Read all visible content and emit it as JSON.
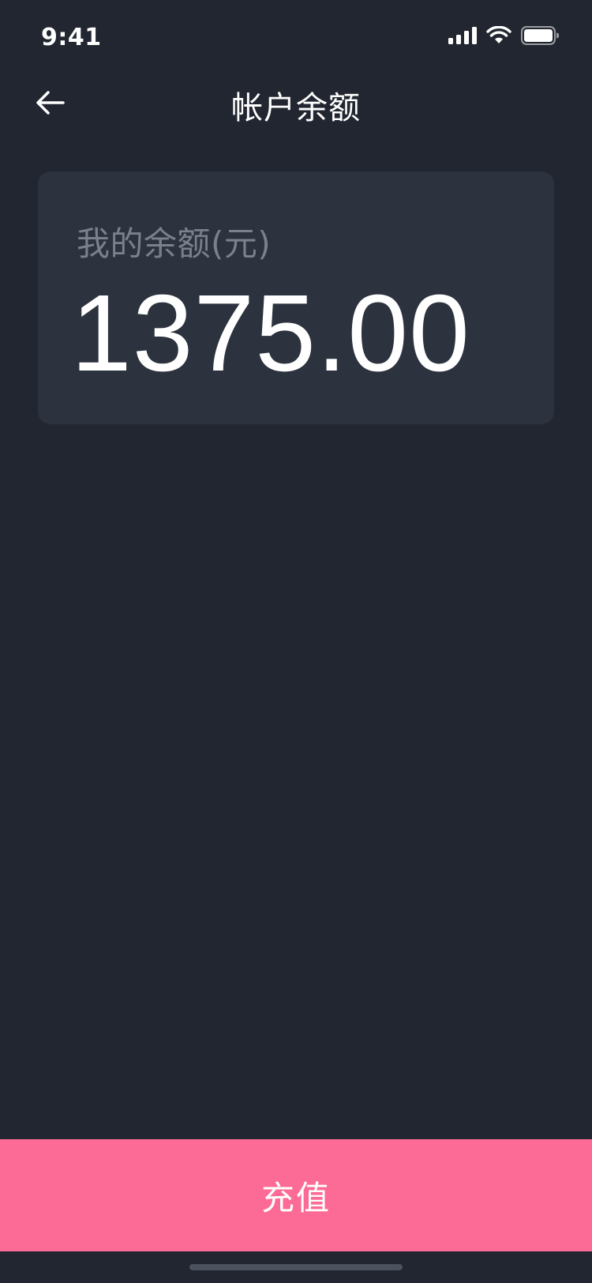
{
  "status_bar": {
    "time": "9:41",
    "icons": [
      "signal-icon",
      "wifi-icon",
      "battery-icon"
    ]
  },
  "nav": {
    "title": "帐户余额",
    "back_icon": "arrow-left-icon"
  },
  "balance_card": {
    "label": "我的余额(元)",
    "amount": "1375.00"
  },
  "actions": {
    "recharge_label": "充值"
  },
  "colors": {
    "background": "#212630",
    "card": "#2c323e",
    "accent": "#fc6b95",
    "label_gray": "#7a808c",
    "text": "#ffffff"
  }
}
